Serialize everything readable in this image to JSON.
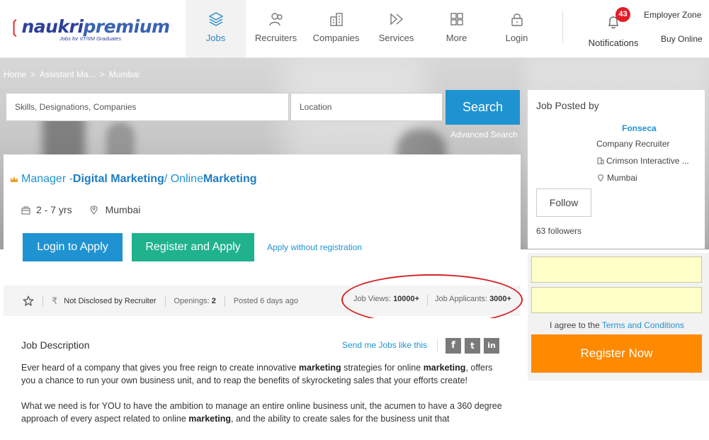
{
  "header": {
    "logo_main_prefix": "naukri",
    "logo_main_suffix": "premium",
    "logo_sub": "Jobs for IIT/IIM Graduates",
    "nav": [
      {
        "label": "Jobs",
        "icon": "layers-icon",
        "active": true
      },
      {
        "label": "Recruiters",
        "icon": "recruiters-icon"
      },
      {
        "label": "Companies",
        "icon": "companies-icon"
      },
      {
        "label": "Services",
        "icon": "services-icon"
      },
      {
        "label": "More",
        "icon": "grid-icon"
      },
      {
        "label": "Login",
        "icon": "lock-icon"
      }
    ],
    "notifications_label": "Notifications",
    "notifications_count": "43",
    "employer_zone": "Employer Zone",
    "buy_online": "Buy Online"
  },
  "breadcrumb": {
    "items": [
      "Home",
      "Assistant Ma...",
      "Mumbai"
    ],
    "separator": ">"
  },
  "search": {
    "skills_placeholder": "Skills, Designations, Companies",
    "location_placeholder": "Location",
    "button": "Search",
    "advanced": "Advanced Search"
  },
  "job": {
    "title_parts": {
      "p1": "Manager - ",
      "b1": "Digital Marketing",
      "p2": " / Online ",
      "b2": "Marketing"
    },
    "experience": "2 - 7 yrs",
    "location": "Mumbai",
    "login_apply": "Login to Apply",
    "register_apply": "Register and Apply",
    "apply_without": "Apply without registration",
    "salary": "Not Disclosed by Recruiter",
    "openings_label": "Openings:",
    "openings_value": "2",
    "posted": "Posted 6 days ago",
    "views_label": "Job Views:",
    "views_value": "10000+",
    "applicants_label": "Job Applicants:",
    "applicants_value": "3000+"
  },
  "description": {
    "title": "Job Description",
    "send_jobs": "Send me Jobs like this",
    "social": {
      "facebook": "f",
      "twitter": "t",
      "linkedin": "in"
    },
    "p1": [
      {
        "t": "Ever heard of a company that gives you free reign to create innovative "
      },
      {
        "b": "marketing"
      },
      {
        "t": " strategies for online "
      },
      {
        "b": "marketing"
      },
      {
        "t": ", offers you a chance to run your own business unit, and to reap the benefits of skyrocketing sales that your efforts create!"
      }
    ],
    "p2": [
      {
        "t": "What we need is for YOU to have the ambition to manage an entire online business unit, the acumen to have a 360 degree approach of every aspect related to online "
      },
      {
        "b": "marketing"
      },
      {
        "t": ", and the ability to create sales for the business unit that"
      }
    ]
  },
  "recruiter": {
    "section_title": "Job Posted by",
    "name": "Fonseca",
    "role": "Company Recruiter",
    "company": "Crimson Interactive ...",
    "location": "Mumbai",
    "follow": "Follow",
    "followers": "63 followers"
  },
  "register": {
    "terms_prefix": "I agree to the ",
    "terms_link": "Terms and Conditions",
    "button": "Register Now"
  },
  "colors": {
    "primary_blue": "#1f93d1",
    "register_green": "#1fb28d",
    "register_orange": "#ff8a00",
    "badge_red": "#e21d26",
    "highlight_red": "#d42020",
    "yellow_input": "#ffffc8"
  }
}
